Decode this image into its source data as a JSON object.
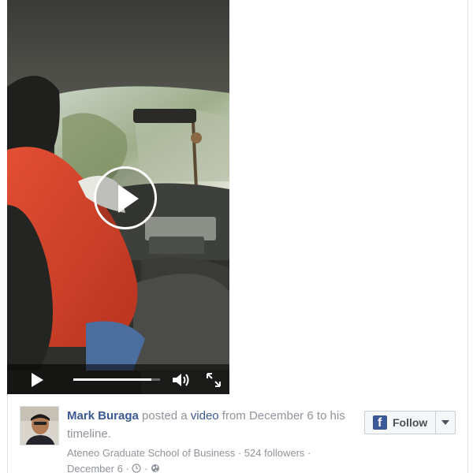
{
  "video": {
    "progress_fraction": 0.9
  },
  "post": {
    "author": "Mark Buraga",
    "verb_1": "posted a",
    "link_video": "video",
    "verb_2": "from December 6",
    "verb_3": "to his timeline.",
    "source": "Ateneo Graduate School of Business",
    "separator": "·",
    "followers": "524 followers",
    "date": "December 6"
  },
  "follow_button": {
    "label": "Follow",
    "icon": "f"
  },
  "icons": {
    "play": "play-icon",
    "volume": "volume-icon",
    "fullscreen": "fullscreen-icon",
    "clock": "clock-icon",
    "globe": "globe-icon",
    "facebook": "facebook-icon",
    "caret": "chevron-down-icon"
  },
  "colors": {
    "link": "#3b5998",
    "muted": "#90949c",
    "jacket_red": "#d2412b"
  }
}
